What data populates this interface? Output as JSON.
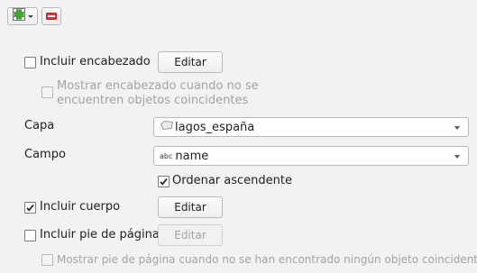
{
  "toolbar": {
    "add_icon": "add-table-icon",
    "remove_icon": "remove-icon"
  },
  "include_header": {
    "label": "Incluir encabezado",
    "checked": false,
    "edit_label": "Editar"
  },
  "show_header_when_empty": {
    "label_line1": "Mostrar encabezado cuando no se",
    "label_line2": "encuentren objetos coincidentes",
    "checked": false,
    "enabled": false
  },
  "layer": {
    "label": "Capa",
    "value": "lagos_españa",
    "icon": "polygon-layer-icon"
  },
  "field": {
    "label": "Campo",
    "value": "name",
    "type_badge": "abc"
  },
  "sort_ascending": {
    "label": "Ordenar ascendente",
    "checked": true
  },
  "include_body": {
    "label": "Incluir cuerpo",
    "checked": true,
    "edit_label": "Editar"
  },
  "include_footer": {
    "label": "Incluir pie de página",
    "checked": false,
    "edit_label": "Editar"
  },
  "show_footer_when_empty": {
    "label": "Mostrar pie de página cuando no se han encontrado ningún objeto coincidente",
    "checked": false,
    "enabled": false
  },
  "colors": {
    "add_green": "#3fa535",
    "remove_red": "#e0353f",
    "disabled_text": "#a3a3a3",
    "background": "#f2f2f2"
  }
}
